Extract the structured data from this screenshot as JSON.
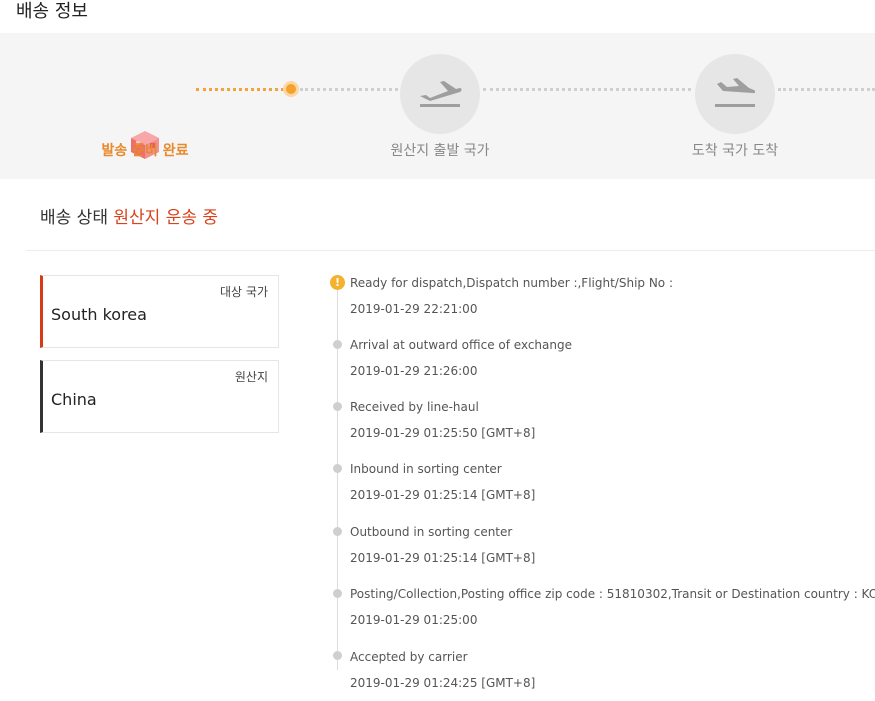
{
  "page_title": "배송 정보",
  "steps": [
    {
      "label": "발송 준비 완료",
      "state": "done",
      "icon": "package-icon"
    },
    {
      "label": "원산지 출발 국가",
      "state": "pending",
      "icon": "plane-departure-icon"
    },
    {
      "label": "도착 국가 도착",
      "state": "pending",
      "icon": "plane-arrival-icon"
    }
  ],
  "status": {
    "prefix": "배송 상태",
    "value": "원산지 운송 중"
  },
  "countries": {
    "destination": {
      "caption": "대상 국가",
      "value": "South korea"
    },
    "origin": {
      "caption": "원산지",
      "value": "China"
    }
  },
  "timeline": [
    {
      "desc": "Ready for dispatch,Dispatch number :,Flight/Ship No :",
      "time": "2019-01-29 22:21:00",
      "icon": "warning-icon"
    },
    {
      "desc": "Arrival at outward office of exchange",
      "time": "2019-01-29 21:26:00"
    },
    {
      "desc": "Received by line-haul",
      "time": "2019-01-29 01:25:50 [GMT+8]"
    },
    {
      "desc": "Inbound in sorting center",
      "time": "2019-01-29 01:25:14 [GMT+8]"
    },
    {
      "desc": "Outbound in sorting center",
      "time": "2019-01-29 01:25:14 [GMT+8]"
    },
    {
      "desc": "Posting/Collection,Posting office zip code : 51810302,Transit or Destination country : KOREA",
      "time": "2019-01-29 01:25:00"
    },
    {
      "desc": "Accepted by carrier",
      "time": "2019-01-29 01:24:25 [GMT+8]"
    }
  ],
  "colors": {
    "accent": "#e8892c",
    "status_highlight": "#d9421a",
    "destination_bar": "#d63a16",
    "origin_bar": "#333333"
  }
}
